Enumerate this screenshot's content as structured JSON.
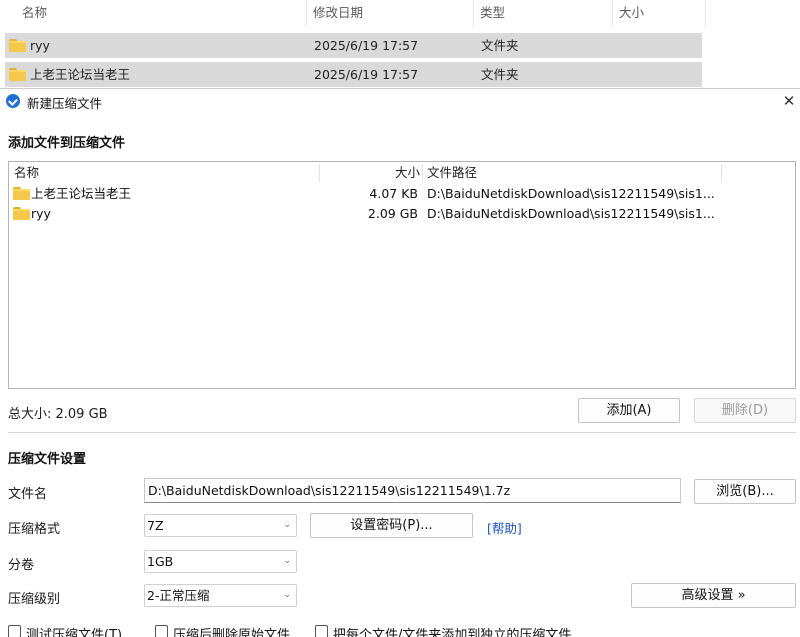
{
  "explorer": {
    "columns": [
      "名称",
      "修改日期",
      "类型",
      "大小"
    ],
    "rows": [
      {
        "name": "ryy",
        "date": "2025/6/19 17:57",
        "type": "文件夹"
      },
      {
        "name": "上老王论坛当老王",
        "date": "2025/6/19 17:57",
        "type": "文件夹"
      }
    ]
  },
  "dialog": {
    "title": "新建压缩文件",
    "close_glyph": "✕",
    "add_section_title": "添加文件到压缩文件",
    "list": {
      "columns": {
        "name": "名称",
        "size": "大小",
        "path": "文件路径"
      },
      "rows": [
        {
          "name": "上老王论坛当老王",
          "size": "4.07 KB",
          "path": "D:\\BaiduNetdiskDownload\\sis12211549\\sis1..."
        },
        {
          "name": "ryy",
          "size": "2.09 GB",
          "path": "D:\\BaiduNetdiskDownload\\sis12211549\\sis1..."
        }
      ]
    },
    "total_size": "总大小: 2.09 GB",
    "add_button": "添加(A)",
    "delete_button": "删除(D)",
    "settings_title": "压缩文件设置",
    "filename_label": "文件名",
    "filename_value": "D:\\BaiduNetdiskDownload\\sis12211549\\sis12211549\\1.7z",
    "browse_button": "浏览(B)...",
    "format_label": "压缩格式",
    "format_value": "7Z",
    "password_button": "设置密码(P)...",
    "help_link": "[帮助]",
    "volume_label": "分卷",
    "volume_value": "1GB",
    "level_label": "压缩级别",
    "level_value": "2-正常压缩",
    "advanced_button": "高级设置 »",
    "checkboxes": [
      "测试压缩文件(T)",
      "压缩后删除原始文件",
      "把每个文件/文件夹添加到独立的压缩文件"
    ]
  },
  "colors": {
    "accent": "#1f6fd6",
    "folder": "#f5c84c",
    "link": "#1a4fc7"
  }
}
